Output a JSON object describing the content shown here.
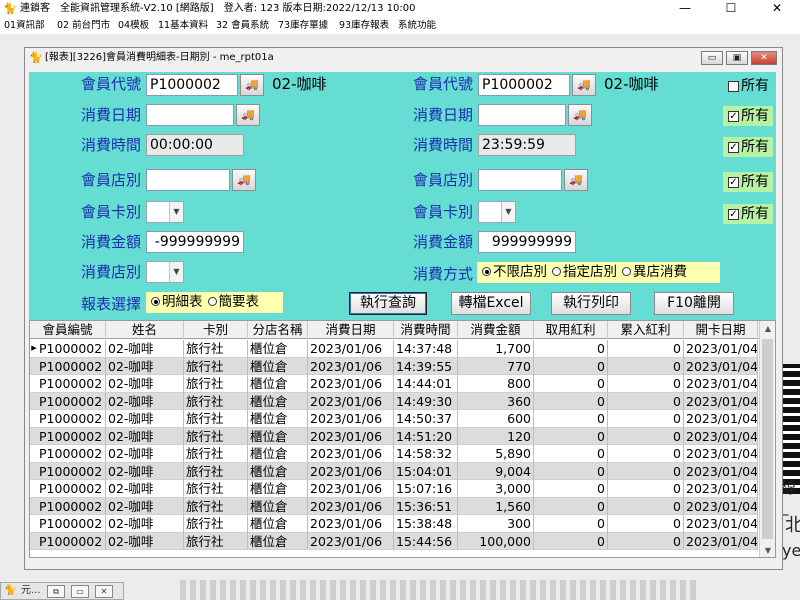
{
  "app": {
    "icon": "cat-logo-icon",
    "title": "連鎖客　全能資訊管理系統-V2.10 [網路版]　登入者: 123 版本日期:2022/12/13 10:00",
    "minimize": "—",
    "maximize": "☐",
    "close": "✕"
  },
  "menu": [
    "01資訊部",
    "02 前台門市",
    "04模板",
    "11基本資料",
    "32 會員系統",
    "73庫存單據",
    "93庫存報表",
    "系統功能"
  ],
  "child": {
    "icon": "cat-logo-icon",
    "title": "[報表][3226]會員消費明細表-日期別 - me_rpt01a",
    "minimize": "▭",
    "restore": "▣",
    "close": "✕"
  },
  "form": {
    "member_code_label": "會員代號",
    "member_code_from": "P1000002",
    "member_name_from": "02-咖啡",
    "member_code_to": "P1000002",
    "member_name_to": "02-咖啡",
    "date_label": "消費日期",
    "date_from": "",
    "date_to": "",
    "time_label": "消費時間",
    "time_from": "00:00:00",
    "time_to": "23:59:59",
    "store_label": "會員店別",
    "store_from": "",
    "store_to": "",
    "card_label": "會員卡別",
    "amount_label": "消費金額",
    "amount_from": "-999999999",
    "amount_to": "999999999",
    "spend_store_label": "消費店別",
    "method_label": "消費方式",
    "method_options": [
      "不限店別",
      "指定店別",
      "異店消費"
    ],
    "method_selected": 0,
    "report_label": "報表選擇",
    "report_options": [
      "明細表",
      "簡要表"
    ],
    "report_selected": 0,
    "all_label": "所有",
    "all_checks": [
      false,
      true,
      true,
      true,
      true
    ],
    "check_mark": "✓"
  },
  "buttons": {
    "query": "執行查詢",
    "export": "轉檔Excel",
    "print": "執行列印",
    "exit": "F10離開"
  },
  "grid": {
    "columns": [
      "會員編號",
      "姓名",
      "卡別",
      "分店名稱",
      "消費日期",
      "消費時間",
      "消費金額",
      "取用紅利",
      "累入紅利",
      "開卡日期"
    ],
    "rows": [
      [
        "P1000002",
        "02-咖啡",
        "旅行社",
        "櫃位倉",
        "2023/01/06",
        "14:37:48",
        "1,700",
        "0",
        "0",
        "2023/01/04"
      ],
      [
        "P1000002",
        "02-咖啡",
        "旅行社",
        "櫃位倉",
        "2023/01/06",
        "14:39:55",
        "770",
        "0",
        "0",
        "2023/01/04"
      ],
      [
        "P1000002",
        "02-咖啡",
        "旅行社",
        "櫃位倉",
        "2023/01/06",
        "14:44:01",
        "800",
        "0",
        "0",
        "2023/01/04"
      ],
      [
        "P1000002",
        "02-咖啡",
        "旅行社",
        "櫃位倉",
        "2023/01/06",
        "14:49:30",
        "360",
        "0",
        "0",
        "2023/01/04"
      ],
      [
        "P1000002",
        "02-咖啡",
        "旅行社",
        "櫃位倉",
        "2023/01/06",
        "14:50:37",
        "600",
        "0",
        "0",
        "2023/01/04"
      ],
      [
        "P1000002",
        "02-咖啡",
        "旅行社",
        "櫃位倉",
        "2023/01/06",
        "14:51:20",
        "120",
        "0",
        "0",
        "2023/01/04"
      ],
      [
        "P1000002",
        "02-咖啡",
        "旅行社",
        "櫃位倉",
        "2023/01/06",
        "14:58:32",
        "5,890",
        "0",
        "0",
        "2023/01/04"
      ],
      [
        "P1000002",
        "02-咖啡",
        "旅行社",
        "櫃位倉",
        "2023/01/06",
        "15:04:01",
        "9,004",
        "0",
        "0",
        "2023/01/04"
      ],
      [
        "P1000002",
        "02-咖啡",
        "旅行社",
        "櫃位倉",
        "2023/01/06",
        "15:07:16",
        "3,000",
        "0",
        "0",
        "2023/01/04"
      ],
      [
        "P1000002",
        "02-咖啡",
        "旅行社",
        "櫃位倉",
        "2023/01/06",
        "15:36:51",
        "1,560",
        "0",
        "0",
        "2023/01/04"
      ],
      [
        "P1000002",
        "02-咖啡",
        "旅行社",
        "櫃位倉",
        "2023/01/06",
        "15:38:48",
        "300",
        "0",
        "0",
        "2023/01/04"
      ],
      [
        "P1000002",
        "02-咖啡",
        "旅行社",
        "櫃位倉",
        "2023/01/06",
        "15:44:56",
        "100,000",
        "0",
        "0",
        "2023/01/04"
      ]
    ]
  },
  "background_text": [
    "線_",
    "北",
    "ye"
  ],
  "taskbar": {
    "label": "元..."
  },
  "colors": {
    "form_bg": "#66ddd3",
    "label_text": "#1a2fae",
    "checked_bg": "#b6f2a3",
    "radio_bg": "#ffffb0",
    "grid_alt_row": "#dcdcdc"
  }
}
